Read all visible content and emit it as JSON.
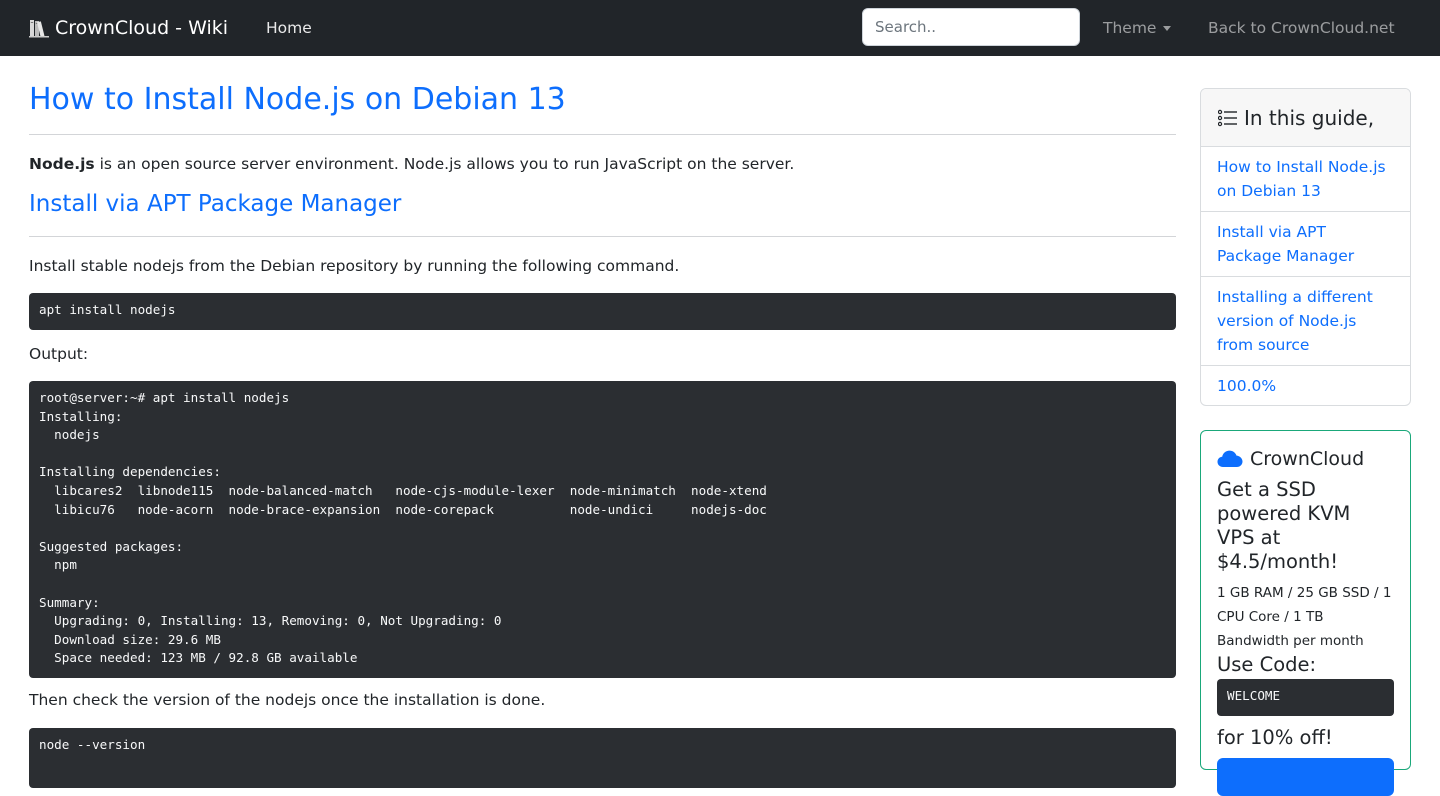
{
  "navbar": {
    "brand": "CrownCloud - Wiki",
    "home": "Home",
    "search_placeholder": "Search..",
    "theme": "Theme",
    "back": "Back to CrownCloud.net"
  },
  "article": {
    "title": "How to Install Node.js on Debian 13",
    "intro_bold": "Node.js",
    "intro_rest": " is an open source server environment. Node.js allows you to run JavaScript on the server.",
    "section_title": "Install via APT Package Manager",
    "install_text": "Install stable nodejs from the Debian repository by running the following command.",
    "install_cmd": "apt install nodejs",
    "output_label": "Output:",
    "output_block": "root@server:~# apt install nodejs\nInstalling:\n  nodejs\n\nInstalling dependencies:\n  libcares2  libnode115  node-balanced-match   node-cjs-module-lexer  node-minimatch  node-xtend\n  libicu76   node-acorn  node-brace-expansion  node-corepack          node-undici     nodejs-doc\n\nSuggested packages:\n  npm\n\nSummary:\n  Upgrading: 0, Installing: 13, Removing: 0, Not Upgrading: 0\n  Download size: 29.6 MB\n  Space needed: 123 MB / 92.8 GB available",
    "check_text": "Then check the version of the nodejs once the installation is done.",
    "version_cmd": "node --version"
  },
  "toc": {
    "title": "In this guide,",
    "items": [
      {
        "label": "How to Install Node.js on Debian 13"
      },
      {
        "label": "Install via APT Package Manager"
      },
      {
        "label": "Installing a different version of Node.js from source"
      },
      {
        "label": "100.0%"
      }
    ]
  },
  "ad": {
    "brand": "CrownCloud",
    "headline": "Get a SSD powered KVM VPS at $4.5/month!",
    "specs": "1 GB RAM / 25 GB SSD / 1 CPU Core / 1 TB Bandwidth per month",
    "use_code": "Use Code:",
    "code": "WELCOME",
    "discount": "for 10% off!"
  },
  "colors": {
    "navbar": "#212529",
    "link": "#0d6efd",
    "code_bg": "#2b2e32",
    "ad_border": "#1aa87a"
  }
}
